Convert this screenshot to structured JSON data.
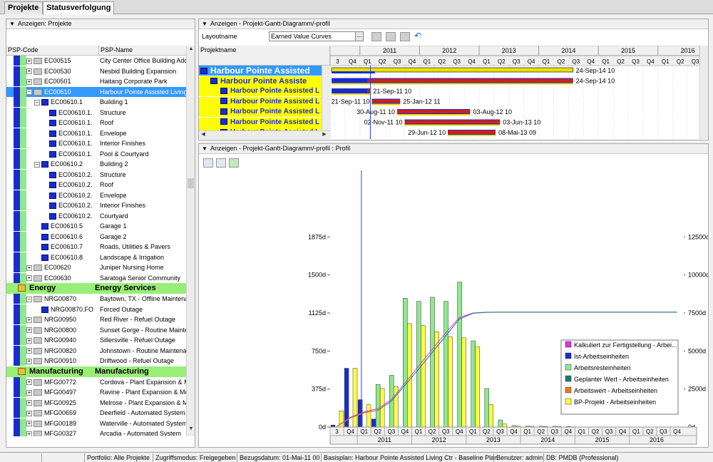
{
  "tabs": [
    {
      "label": "Projekte"
    },
    {
      "label": "Statusverfolgung"
    }
  ],
  "left_panel": {
    "title": "Anzeigen: Projekte",
    "col_code": "PSP-Code",
    "col_name": "PSP-Name",
    "rows": [
      {
        "kind": "item",
        "icon": "folder",
        "exp": "+",
        "indent": 0,
        "code": "EC00515",
        "name": "City Center Office Building Additi"
      },
      {
        "kind": "item",
        "icon": "folder",
        "exp": "+",
        "indent": 0,
        "code": "EC00530",
        "name": "Nesbid Building Expansion"
      },
      {
        "kind": "item",
        "icon": "folder",
        "exp": "+",
        "indent": 0,
        "code": "EC00501",
        "name": "Haitang Corporate Park"
      },
      {
        "kind": "sel",
        "icon": "folder",
        "exp": "−",
        "indent": 0,
        "code": "EC00610",
        "name": "Harbour Pointe Assisted Living C"
      },
      {
        "kind": "item",
        "icon": "wbs",
        "exp": "−",
        "indent": 1,
        "code": "EC00610.1",
        "name": "Building 1"
      },
      {
        "kind": "item",
        "icon": "wbs",
        "exp": "",
        "indent": 2,
        "code": "EC00610.1.",
        "name": "Structure"
      },
      {
        "kind": "item",
        "icon": "wbs",
        "exp": "",
        "indent": 2,
        "code": "EC00610.1.",
        "name": "Roof"
      },
      {
        "kind": "item",
        "icon": "wbs",
        "exp": "",
        "indent": 2,
        "code": "EC00610.1.",
        "name": "Envelope"
      },
      {
        "kind": "item",
        "icon": "wbs",
        "exp": "",
        "indent": 2,
        "code": "EC00610.1.",
        "name": "Interior Finishes"
      },
      {
        "kind": "item",
        "icon": "wbs",
        "exp": "",
        "indent": 2,
        "code": "EC00610.1.",
        "name": "Pool & Courtyard"
      },
      {
        "kind": "item",
        "icon": "wbs",
        "exp": "−",
        "indent": 1,
        "code": "EC00610.2",
        "name": "Building 2"
      },
      {
        "kind": "item",
        "icon": "wbs",
        "exp": "",
        "indent": 2,
        "code": "EC00610.2.",
        "name": "Structure"
      },
      {
        "kind": "item",
        "icon": "wbs",
        "exp": "",
        "indent": 2,
        "code": "EC00610.2.",
        "name": "Roof"
      },
      {
        "kind": "item",
        "icon": "wbs",
        "exp": "",
        "indent": 2,
        "code": "EC00610.2.",
        "name": "Envelope"
      },
      {
        "kind": "item",
        "icon": "wbs",
        "exp": "",
        "indent": 2,
        "code": "EC00610.2.",
        "name": "Interior Finishes"
      },
      {
        "kind": "item",
        "icon": "wbs",
        "exp": "",
        "indent": 2,
        "code": "EC00610.2.",
        "name": "Courtyard"
      },
      {
        "kind": "item",
        "icon": "wbs",
        "exp": "",
        "indent": 1,
        "code": "EC00610.5",
        "name": "Garage 1"
      },
      {
        "kind": "item",
        "icon": "wbs",
        "exp": "",
        "indent": 1,
        "code": "EC00610.6",
        "name": "Garage 2"
      },
      {
        "kind": "item",
        "icon": "wbs",
        "exp": "",
        "indent": 1,
        "code": "EC00610.7",
        "name": "Roads, Utilities & Pavers"
      },
      {
        "kind": "item",
        "icon": "wbs",
        "exp": "",
        "indent": 1,
        "code": "EC00610.8",
        "name": "Landscape & Irrigation"
      },
      {
        "kind": "item",
        "icon": "folder",
        "exp": "+",
        "indent": 0,
        "code": "EC00620",
        "name": "Juniper Nursing Home"
      },
      {
        "kind": "item",
        "icon": "folder",
        "exp": "+",
        "indent": 0,
        "code": "EC00630",
        "name": "Saratoga Senior Community"
      },
      {
        "kind": "group",
        "code": "Energy",
        "name": "Energy Services"
      },
      {
        "kind": "item",
        "icon": "folder",
        "exp": "−",
        "indent": 0,
        "code": "NRG00870",
        "name": "Baytown, TX - Offline Maintenan"
      },
      {
        "kind": "item",
        "icon": "wbs",
        "exp": "",
        "indent": 1,
        "code": "NRG00870.FO",
        "name": "Forced Outage"
      },
      {
        "kind": "item",
        "icon": "folder",
        "exp": "+",
        "indent": 0,
        "code": "NRG00950",
        "name": "Red River - Refuel Outage"
      },
      {
        "kind": "item",
        "icon": "folder",
        "exp": "+",
        "indent": 0,
        "code": "NRG00800",
        "name": "Sunset Gorge - Routine Maintena"
      },
      {
        "kind": "item",
        "icon": "folder",
        "exp": "+",
        "indent": 0,
        "code": "NRG00940",
        "name": "Sillersville - Refuel Outage"
      },
      {
        "kind": "item",
        "icon": "folder",
        "exp": "+",
        "indent": 0,
        "code": "NRG00820",
        "name": "Johnstown - Routine Maintenanc"
      },
      {
        "kind": "item",
        "icon": "folder",
        "exp": "+",
        "indent": 0,
        "code": "NRG00910",
        "name": "Driftwood - Refuel Outage"
      },
      {
        "kind": "group",
        "code": "Manufacturing",
        "name": "Manufacturing"
      },
      {
        "kind": "item",
        "icon": "folder",
        "exp": "+",
        "indent": 0,
        "code": "MFG00772",
        "name": "Cordova - Plant Expansion & Moc"
      },
      {
        "kind": "item",
        "icon": "folder",
        "exp": "+",
        "indent": 0,
        "code": "MFG00497",
        "name": "Ravine - Plant Expansion & Mod"
      },
      {
        "kind": "item",
        "icon": "folder",
        "exp": "+",
        "indent": 0,
        "code": "MFG00925",
        "name": "Melrose - Plant Expansion & Mod"
      },
      {
        "kind": "item",
        "icon": "folder",
        "exp": "+",
        "indent": 0,
        "code": "MFG00659",
        "name": "Deerfield - Automated System"
      },
      {
        "kind": "item",
        "icon": "folder",
        "exp": "+",
        "indent": 0,
        "code": "MFG00189",
        "name": "Waterville - Automated System"
      },
      {
        "kind": "item",
        "icon": "folder",
        "exp": "+",
        "indent": 0,
        "code": "MFG00327",
        "name": "Arcadia - Automated System"
      }
    ]
  },
  "gantt_panel": {
    "title": "Anzeigen - Projekt-Gantt-Diagramm/-profil",
    "layout_label": "Layoutname",
    "layout_value": "Earned Value Curves",
    "col_project": "Projektname",
    "years": [
      "2011",
      "2012",
      "2013",
      "2014",
      "2015",
      "2016"
    ],
    "quarters": [
      "3",
      "Q4",
      "Q1",
      "Q2",
      "Q3",
      "Q4",
      "Q1",
      "Q2",
      "Q3",
      "Q4",
      "Q1",
      "Q2",
      "Q3",
      "Q4",
      "Q1",
      "Q2",
      "Q3",
      "Q4",
      "Q1",
      "Q2",
      "Q3",
      "Q4",
      "Q1",
      "Q2",
      "Q3",
      "Q4"
    ],
    "rows": [
      {
        "name": "Harbour Pointe Assisted",
        "level": 0,
        "bar_label": "24-Sep-14 10"
      },
      {
        "name": "Harbour Pointe Assiste",
        "level": 1,
        "bar_label": "24-Sep-14 10"
      },
      {
        "name": "Harbour Pointe Assisted L",
        "level": 2,
        "bar_label_left": "",
        "bar_label": "21-Sep-11 10"
      },
      {
        "name": "Harbour Pointe Assisted L",
        "level": 2,
        "bar_label_left": "21-Sep-11 10",
        "bar_label": "25-Jan-12 11"
      },
      {
        "name": "Harbour Pointe Assisted L",
        "level": 2,
        "bar_label_left": "30-Aug-11 10",
        "bar_label": "03-Aug-12 10"
      },
      {
        "name": "Harbour Pointe Assisted L",
        "level": 2,
        "bar_label_left": "02-Nov-11 10",
        "bar_label": "03-Jun-13 10"
      },
      {
        "name": "Harbour Pointe Assisted L",
        "level": 2,
        "bar_label_left": "29-Jun-12 10",
        "bar_label": "08-Mai-13 09"
      }
    ]
  },
  "profile_panel": {
    "title": "Anzeigen - Projekt-Gantt-Diagramm/-profil : Profil"
  },
  "chart_data": {
    "type": "bar",
    "left_axis_ticks": [
      "0d",
      "375d",
      "750d",
      "1125d",
      "1500d",
      "1875d"
    ],
    "right_axis_ticks": [
      "0d",
      "2500d",
      "5000d",
      "7500d",
      "10000d",
      "12500d"
    ],
    "ylim_left": [
      0,
      2250
    ],
    "ylim_right": [
      0,
      15000
    ],
    "categories": [
      "Q3 2010",
      "Q4 2010",
      "Q1 2011",
      "Q2 2011",
      "Q3 2011",
      "Q4 2011",
      "Q1 2012",
      "Q2 2012",
      "Q3 2012",
      "Q4 2012",
      "Q1 2013",
      "Q2 2013",
      "Q3 2013",
      "Q4 2013",
      "Q1 2014",
      "Q2 2014",
      "Q3 2014",
      "Q4 2014",
      "Q1 2015",
      "Q2 2015",
      "Q3 2015",
      "Q4 2015",
      "Q1 2016",
      "Q2 2016",
      "Q3 2016",
      "Q4 2016"
    ],
    "series": [
      {
        "name": "Ist-Arbeitseinheiten",
        "color": "#1b2ccc",
        "values": [
          20,
          580,
          270,
          80,
          0,
          0,
          0,
          0,
          0,
          0,
          0,
          0,
          0,
          0,
          0,
          0,
          0,
          0,
          0,
          0,
          0,
          0,
          0,
          0,
          0,
          0
        ]
      },
      {
        "name": "Arbeitsresteinheiten",
        "color": "#8ee88e",
        "values": [
          0,
          0,
          0,
          420,
          510,
          1270,
          1240,
          1280,
          1240,
          1430,
          850,
          380,
          70,
          15,
          10,
          8,
          8,
          5,
          0,
          0,
          0,
          0,
          0,
          0,
          0,
          0
        ]
      },
      {
        "name": "BP-Projekt - Arbeitseinheiten",
        "color": "#ffff44",
        "values": [
          160,
          580,
          220,
          380,
          400,
          1020,
          1000,
          940,
          890,
          880,
          790,
          220,
          30,
          10,
          8,
          5,
          5,
          3,
          0,
          0,
          0,
          0,
          0,
          0,
          0,
          0
        ]
      }
    ],
    "cumulative_series": [
      {
        "name": "Kalkuliert zur Fertigstellung - Arbeit",
        "color": "#e030e0",
        "values": [
          50,
          650,
          1000,
          1200,
          1800,
          2900,
          4000,
          5100,
          6200,
          7200,
          7500,
          7550,
          7560,
          7560,
          7560,
          7560,
          7560,
          7560,
          7560,
          7560,
          7560,
          7560,
          7560,
          7560,
          7560,
          7560
        ]
      },
      {
        "name": "Geplanter Wert - Arbeitseinheiten",
        "color": "#108070",
        "values": [
          50,
          620,
          950,
          1100,
          1700,
          2750,
          3800,
          4900,
          6000,
          7100,
          7480,
          7540,
          7550,
          7550,
          7550,
          7550,
          7550,
          7550,
          7550,
          7550,
          7550,
          7550,
          7550,
          7550,
          7550,
          7550
        ]
      },
      {
        "name": "Arbeitswert - Arbeitseinheiten",
        "color": "#ee7722",
        "values": [
          40,
          600,
          930,
          1100,
          null,
          null,
          null,
          null,
          null,
          null,
          null,
          null,
          null,
          null,
          null,
          null,
          null,
          null,
          null,
          null,
          null,
          null,
          null,
          null,
          null,
          null
        ]
      }
    ],
    "legend": [
      {
        "label": "Kalkuliert zur Fertigstellung - Arbei...",
        "color": "#e030e0"
      },
      {
        "label": "Ist-Arbeitseinheiten",
        "color": "#1b2ccc"
      },
      {
        "label": "Arbeitsresteinheiten",
        "color": "#8ee88e"
      },
      {
        "label": "Geplanter Wert - Arbeitseinheiten",
        "color": "#108070"
      },
      {
        "label": "Arbeitswert - Arbeitseinheiten",
        "color": "#ee7722"
      },
      {
        "label": "BP-Projekt - Arbeitseinheiten",
        "color": "#ffff44"
      }
    ],
    "legend_position": "bottom-right",
    "x_years": [
      "2011",
      "2012",
      "2013",
      "2014",
      "2015",
      "2016"
    ],
    "data_date": "Q2 2011"
  },
  "status": {
    "portfolio": "Portfolio: Alle Projekte",
    "access": "Zugriffsmodus: Freigegeben",
    "date": "Bezugsdatum: 01-Mai-11 00",
    "baseline": "Basisplan: Harbour Pointe Assisted Living Ctr - Baseline Plan",
    "user": "Benutzer: admin",
    "db": "DB: PMDB (Professional)"
  }
}
